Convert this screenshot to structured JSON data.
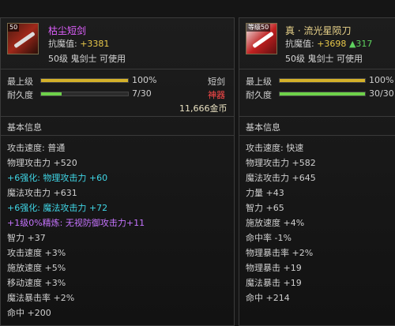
{
  "left": {
    "level_badge": "50",
    "name": "枯尘短剑",
    "resist_label": "抗魔值:",
    "resist_value": "+3381",
    "requirement": "50级 鬼剑士 可使用",
    "max_level_label": "最上级",
    "max_level_percent": "100%",
    "max_level_fill": 1.0,
    "type": "短剑",
    "durability_label": "耐久度",
    "durability": "7/30",
    "durability_fill": 0.2333,
    "tier": "神器",
    "price": "11,666金币",
    "section_title": "基本信息",
    "stats": [
      {
        "text": "攻击速度: 普通",
        "color": "white"
      },
      {
        "text": "物理攻击力 +520",
        "color": "white"
      },
      {
        "text": "+6强化: 物理攻击力 +60",
        "color": "cyan"
      },
      {
        "text": "魔法攻击力 +631",
        "color": "white"
      },
      {
        "text": "+6强化: 魔法攻击力 +72",
        "color": "cyan"
      },
      {
        "text": "+1级0%精炼: 无视防御攻击力+11",
        "color": "purple"
      },
      {
        "text": "智力 +37",
        "color": "white"
      },
      {
        "text": "攻击速度 +3%",
        "color": "white"
      },
      {
        "text": "施放速度 +5%",
        "color": "white"
      },
      {
        "text": "移动速度 +3%",
        "color": "white"
      },
      {
        "text": "魔法暴击率 +2%",
        "color": "white"
      },
      {
        "text": "命中 +200",
        "color": "white"
      }
    ]
  },
  "right": {
    "level_badge": "等级50",
    "name": "真 · 流光星陨刀",
    "resist_label": "抗魔值:",
    "resist_value": "+3698",
    "resist_up": "▲317",
    "requirement": "50级 鬼剑士 可使用",
    "max_level_label": "最上级",
    "max_level_percent": "100%",
    "max_level_fill": 1.0,
    "durability_label": "耐久度",
    "durability": "30/30",
    "durability_fill": 1.0,
    "section_title": "基本信息",
    "stats": [
      {
        "text": "攻击速度: 快速",
        "color": "white"
      },
      {
        "text": "物理攻击力 +582",
        "color": "white"
      },
      {
        "text": "魔法攻击力 +645",
        "color": "white"
      },
      {
        "text": "力量 +43",
        "color": "white"
      },
      {
        "text": "智力 +65",
        "color": "white"
      },
      {
        "text": "施放速度 +4%",
        "color": "white"
      },
      {
        "text": "命中率 -1%",
        "color": "white"
      },
      {
        "text": "物理暴击率 +2%",
        "color": "white"
      },
      {
        "text": "物理暴击 +19",
        "color": "white"
      },
      {
        "text": "魔法暴击 +19",
        "color": "white"
      },
      {
        "text": "命中 +214",
        "color": "white"
      }
    ]
  },
  "colors": {
    "legendary_name": "#e060ff",
    "rare_name": "#e8d28a",
    "gold_bar": "#d4b12a",
    "green_bar": "#6ed24a",
    "cyan": "#3fd6e6",
    "purple": "#c674ff",
    "red": "#ff4a4a"
  }
}
